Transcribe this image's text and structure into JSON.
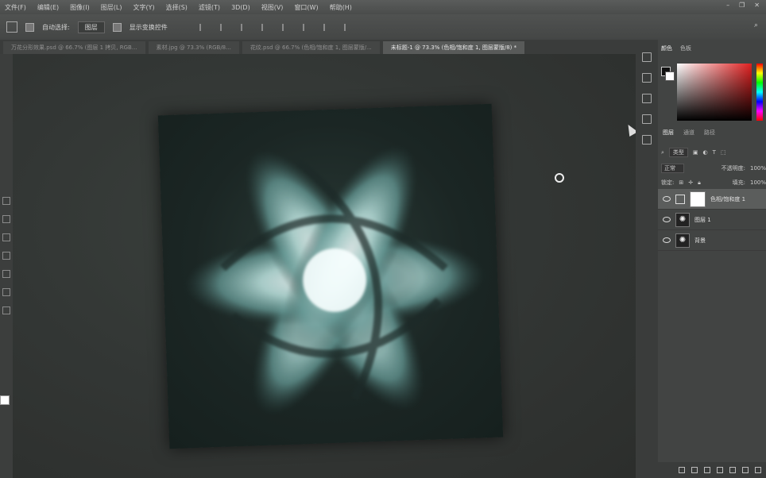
{
  "menu": [
    "文件(F)",
    "编辑(E)",
    "图像(I)",
    "图层(L)",
    "文字(Y)",
    "选择(S)",
    "滤镜(T)",
    "3D(D)",
    "视图(V)",
    "窗口(W)",
    "帮助(H)"
  ],
  "options": {
    "auto_select_label": "自动选择:",
    "auto_select_value": "图层",
    "show_transform_label": "显示变换控件"
  },
  "tabs": [
    "万花分形效果.psd @ 66.7% (图层 1 拷贝, RGB...",
    "素材.jpg @ 73.3% (RGB/8...",
    "花纹.psd @ 66.7% (色相/饱和度 1, 图层蒙版/...",
    "未标题-1 @ 73.3% (色相/饱和度 1, 图层蒙版/8) *"
  ],
  "panel": {
    "color_tab": "颜色",
    "swatch_tab": "色板",
    "layers_tab": "图层",
    "channels_tab": "通道",
    "paths_tab": "路径",
    "kind": "类型",
    "blend_mode": "正常",
    "opacity_label": "不透明度:",
    "opacity_value": "100%",
    "lock_label": "锁定:",
    "fill_label": "填充:",
    "fill_value": "100%"
  },
  "layers": [
    {
      "name": "色相/饱和度 1",
      "visible": true,
      "selected": true
    },
    {
      "name": "图层 1",
      "visible": true,
      "selected": false
    },
    {
      "name": "背景",
      "visible": true,
      "selected": false
    }
  ],
  "colors": {
    "accent": "#e02020",
    "canvas_bg": "#1b2624",
    "glow": "#cfeeee"
  }
}
